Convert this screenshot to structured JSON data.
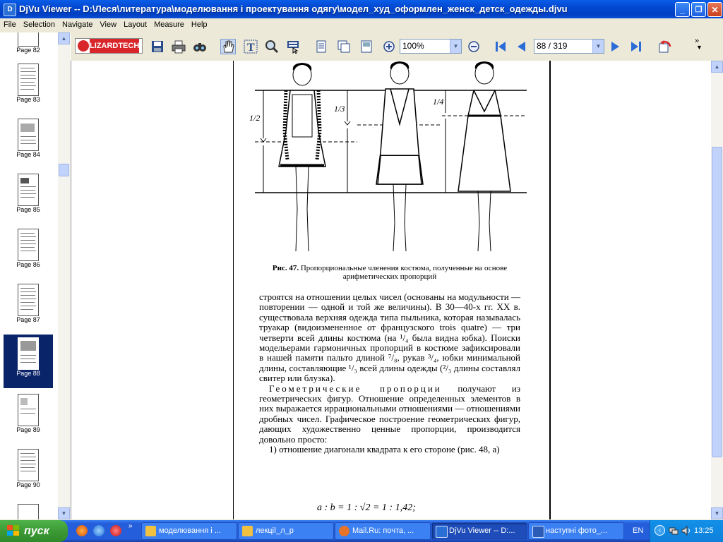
{
  "window": {
    "title": "DjVu Viewer -- D:\\Леся\\литература\\моделювання і проектування одягу\\модел_худ_оформлен_женск_детск_одежды.djvu",
    "minimize_glyph": "_",
    "maximize_glyph": "❐",
    "close_glyph": "✕"
  },
  "menu": [
    "File",
    "Selection",
    "Navigate",
    "View",
    "Layout",
    "Measure",
    "Help"
  ],
  "toolbar": {
    "logo_text": "LIZARDTECH",
    "zoom_value": "100%",
    "page_value": "88 / 319",
    "overflow_glyph": "»",
    "drop_glyph": "▼"
  },
  "thumbnails": {
    "items": [
      {
        "label": "Page 82"
      },
      {
        "label": "Page 83"
      },
      {
        "label": "Page 84"
      },
      {
        "label": "Page 85"
      },
      {
        "label": "Page 86"
      },
      {
        "label": "Page 87"
      },
      {
        "label": "Page 88",
        "selected": true
      },
      {
        "label": "Page 89"
      },
      {
        "label": "Page 90"
      },
      {
        "label": ""
      }
    ]
  },
  "document": {
    "figure_labels": {
      "left": "1/2",
      "middle": "1/3",
      "right": "1/4"
    },
    "caption_bold": "Рис. 47.",
    "caption_text": "Пропорциональные членения костюма, полученные на основе арифметических пропорций",
    "paragraph1": "строятся на отношении целых чисел (основаны на модульности — повторении — одной и той же величины). В 30—40-х гг. XX в. существовала верхняя одежда типа пыльника, которая называлась труакар (видоизмененное от французского trois quatre) — три четверти всей длины костюма (на ¹/₄ была видна юбка). Поиски модельерами гармоничных пропорций в костюме зафиксировали в нашей памяти пальто длиной ⁷/₈, рукав ³/₄, юбки минимальной длины, составляющие ¹/₃ всей длины одежды (²/₃ длины составлял свитер или блузка).",
    "paragraph2_spaced": "Геометрические пропорции",
    "paragraph2_rest": " получают из геометрических фигур. Отношение определенных элементов в них выражается иррациональными отношениями — отношениями дробных чисел. Графическое построение геометрических фигур, дающих художественно ценные пропорции, производится довольно просто:",
    "paragraph3": "1) отношение диагонали квадрата к его стороне (рис. 48, а)",
    "formula": "a : b = 1 : √2 = 1 : 1,42;"
  },
  "scroll": {
    "up_glyph": "▲",
    "down_glyph": "▼",
    "grip_glyph": "≡"
  },
  "taskbar": {
    "start_label": "пуск",
    "more_glyph": "»",
    "tasks": [
      {
        "label": "моделювання і ...",
        "color": "#f0c040"
      },
      {
        "label": "лекції_л_р",
        "color": "#f0c040"
      },
      {
        "label": "Mail.Ru: почта, ...",
        "color": "#e8742a"
      },
      {
        "label": "DjVu Viewer -- D:...",
        "color": "#2a6fd6",
        "active": true
      },
      {
        "label": "наступні фото_...",
        "color": "#2a5cb8"
      }
    ],
    "language": "EN",
    "tray_arrow": "‹",
    "clock": "13:25"
  }
}
